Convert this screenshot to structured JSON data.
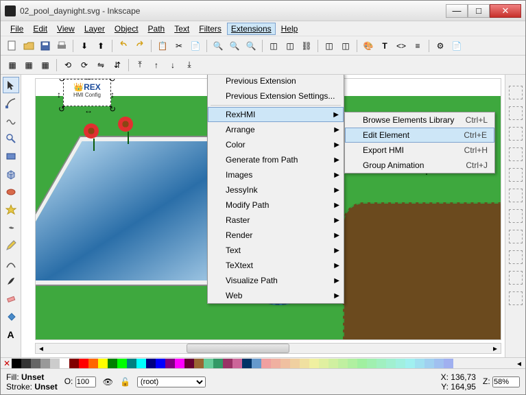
{
  "window": {
    "title": "02_pool_daynight.svg - Inkscape"
  },
  "menubar": [
    "File",
    "Edit",
    "View",
    "Layer",
    "Object",
    "Path",
    "Text",
    "Filters",
    "Extensions",
    "Help"
  ],
  "menubar_active_index": 8,
  "extensions_menu": {
    "header": [
      "Previous Extension",
      "Previous Extension Settings..."
    ],
    "items": [
      "RexHMI",
      "Arrange",
      "Color",
      "Generate from Path",
      "Images",
      "JessyInk",
      "Modify Path",
      "Raster",
      "Render",
      "Text",
      "TeXtext",
      "Visualize Path",
      "Web"
    ],
    "active_index": 0
  },
  "rexhmi_submenu": {
    "items": [
      {
        "label": "Browse Elements Library",
        "shortcut": "Ctrl+L"
      },
      {
        "label": "Edit Element",
        "shortcut": "Ctrl+E"
      },
      {
        "label": "Export HMI",
        "shortcut": "Ctrl+H"
      },
      {
        "label": "Group Animation",
        "shortcut": "Ctrl+J"
      }
    ],
    "active_index": 1
  },
  "selected_object": {
    "label": "HMI Config",
    "brand": "REX"
  },
  "status": {
    "fill_label": "Fill:",
    "fill_value": "Unset",
    "stroke_label": "Stroke:",
    "stroke_value": "Unset",
    "opacity_label": "O:",
    "opacity_value": "100",
    "layer": "(root)",
    "x_label": "X:",
    "x_value": "136,73",
    "y_label": "Y:",
    "y_value": "164,95",
    "zoom_label": "Z:",
    "zoom_value": "58%"
  },
  "palette_colors": [
    "#000000",
    "#333333",
    "#666666",
    "#999999",
    "#cccccc",
    "#ffffff",
    "#800000",
    "#ff0000",
    "#ff6600",
    "#ffff00",
    "#008000",
    "#00ff00",
    "#008080",
    "#00ffff",
    "#000080",
    "#0000ff",
    "#800080",
    "#ff00ff",
    "#660033",
    "#996633",
    "#66cc99",
    "#339966",
    "#993366",
    "#cc6699",
    "#003366",
    "#6699cc",
    "#f0a0a0",
    "#f0b0a0",
    "#f0c0a0",
    "#f0d0a0",
    "#f0e0a0",
    "#f0f0a0",
    "#e0f0a0",
    "#d0f0a0",
    "#c0f0a0",
    "#b0f0a0",
    "#a0f0a0",
    "#a0f0b0",
    "#a0f0c0",
    "#a0f0d0",
    "#a0f0e0",
    "#a0f0f0",
    "#a0e0f0",
    "#a0d0f0",
    "#a0c0f0",
    "#a0b0f0"
  ],
  "palette_none": "✕"
}
